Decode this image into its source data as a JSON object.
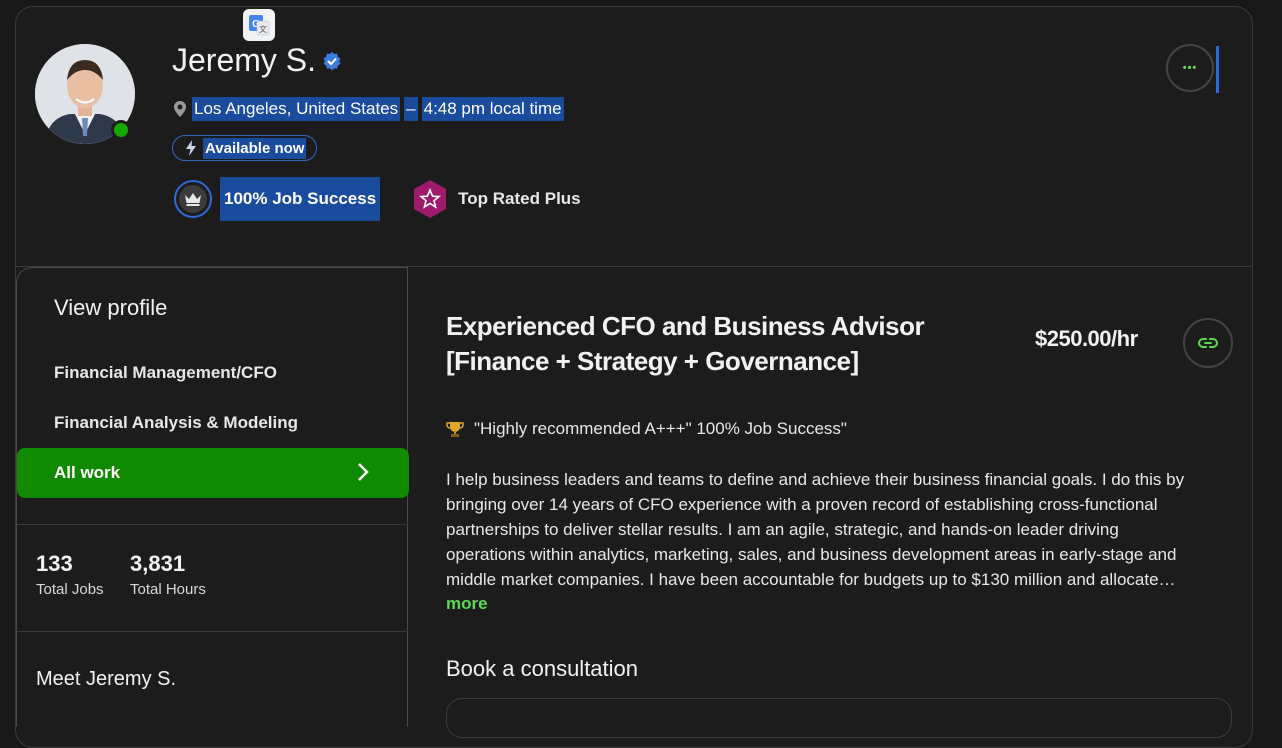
{
  "profile": {
    "name": "Jeremy S.",
    "location": "Los Angeles, United States",
    "separator": "–",
    "local_time": "4:48 pm local time",
    "availability": "Available now",
    "job_success": "100% Job Success",
    "badge": "Top Rated Plus",
    "more_glyph": "•••"
  },
  "sidebar": {
    "title": "View profile",
    "items": [
      {
        "label": "Financial Management/CFO"
      },
      {
        "label": "Financial Analysis & Modeling"
      },
      {
        "label": "All work"
      }
    ],
    "stats": [
      {
        "value": "133",
        "label": "Total Jobs"
      },
      {
        "value": "3,831",
        "label": "Total Hours"
      }
    ],
    "meet": "Meet Jeremy S."
  },
  "main": {
    "title_line1": "Experienced CFO and Business Advisor",
    "title_line2": "[Finance + Strategy + Governance]",
    "rate": "$250.00/hr",
    "quote": "\"Highly recommended A+++\" 100% Job Success\"",
    "bio_lines": [
      "I help business leaders and teams to define and achieve their business financial goals. I do this by",
      "bringing over 14 years of CFO experience with a proven record of establishing cross-functional",
      "partnerships to deliver stellar results. I am an agile, strategic, and hands-on leader driving",
      "operations within analytics, marketing, sales, and business development areas in early-stage and",
      "middle market companies. I have been accountable for budgets up to $130 million and allocate…"
    ],
    "more_label": "more",
    "book_title": "Book a consultation"
  },
  "colors": {
    "accent_green": "#14a800",
    "link_green": "#5bd957",
    "highlight_blue": "#1a4b9c",
    "top_rated_magenta": "#9e1b6b"
  },
  "icons": [
    "translate-icon",
    "verified-icon",
    "location-pin-icon",
    "lightning-icon",
    "crown-icon",
    "star-badge-icon",
    "ellipsis-icon",
    "chevron-right-icon",
    "link-icon",
    "trophy-icon"
  ]
}
